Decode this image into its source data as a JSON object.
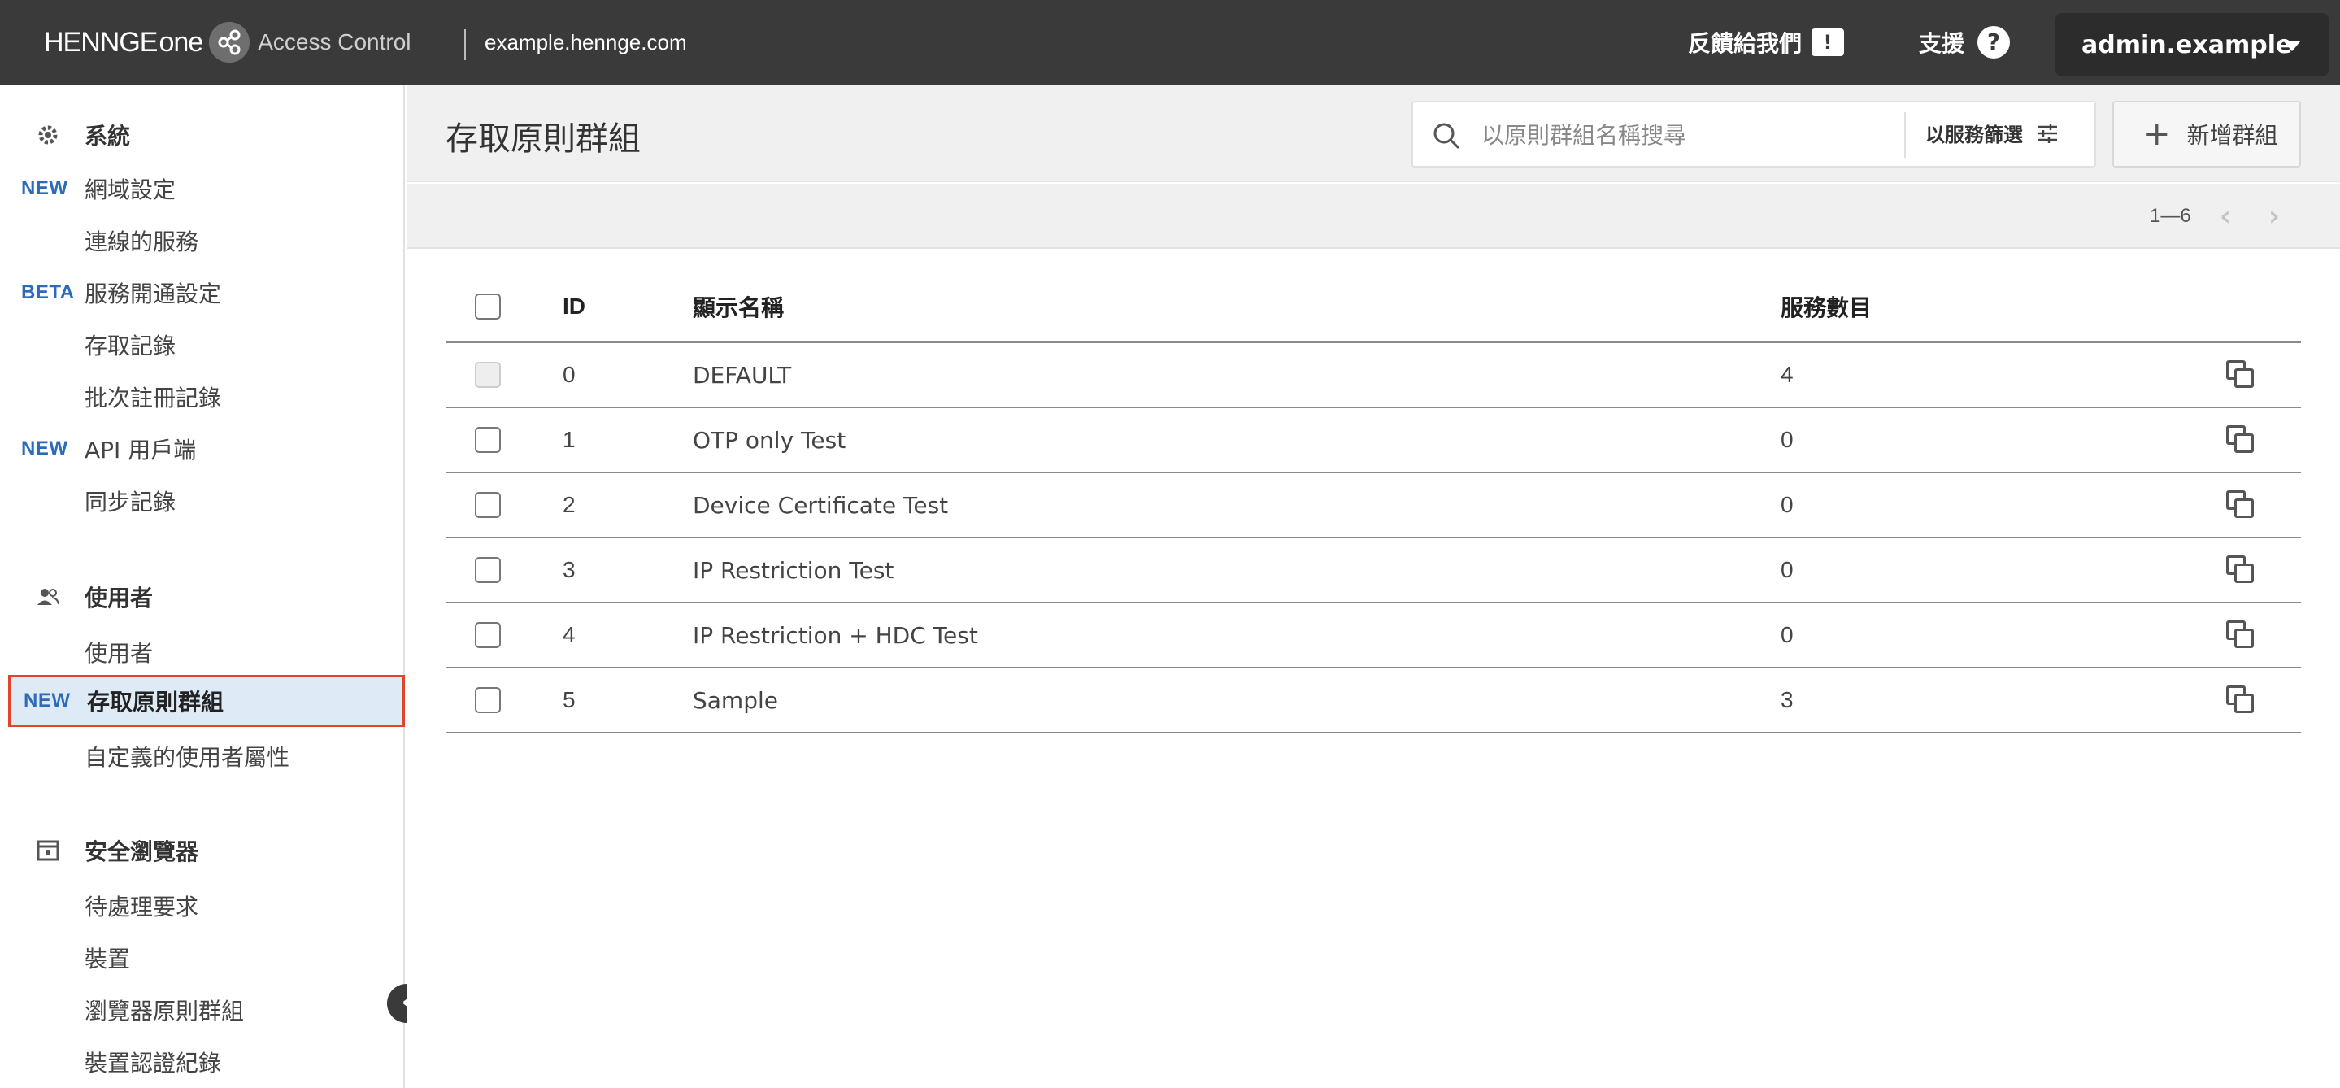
{
  "header": {
    "brand_main": "HENNGE",
    "brand_one": "one",
    "brand_app": "Access Control",
    "domain": "example.hennge.com",
    "feedback_label": "反饋給我們",
    "support_label": "支援",
    "account_label": "admin.example"
  },
  "sidebar": {
    "sections": [
      {
        "label": "系統",
        "icon": "gear-icon",
        "items": [
          {
            "tag": "NEW",
            "label": "網域設定"
          },
          {
            "tag": "",
            "label": "連線的服務"
          },
          {
            "tag": "BETA",
            "label": "服務開通設定"
          },
          {
            "tag": "",
            "label": "存取記錄"
          },
          {
            "tag": "",
            "label": "批次註冊記錄"
          },
          {
            "tag": "NEW",
            "label": "API 用戶端"
          },
          {
            "tag": "",
            "label": "同步記錄"
          }
        ]
      },
      {
        "label": "使用者",
        "icon": "users-icon",
        "items": [
          {
            "tag": "",
            "label": "使用者"
          },
          {
            "tag": "NEW",
            "label": "存取原則群組"
          },
          {
            "tag": "",
            "label": "自定義的使用者屬性"
          }
        ]
      },
      {
        "label": "安全瀏覽器",
        "icon": "browser-icon",
        "items": [
          {
            "tag": "",
            "label": "待處理要求"
          },
          {
            "tag": "",
            "label": "裝置"
          },
          {
            "tag": "",
            "label": "瀏覽器原則群組"
          },
          {
            "tag": "",
            "label": "裝置認證紀錄"
          }
        ]
      }
    ]
  },
  "main": {
    "title": "存取原則群組",
    "search_placeholder": "以原則群組名稱搜尋",
    "filter_label": "以服務篩選",
    "add_label": "新增群組",
    "pager_range": "1—6",
    "columns": {
      "id": "ID",
      "name": "顯示名稱",
      "count": "服務數目"
    },
    "rows": [
      {
        "id": "0",
        "name": "DEFAULT",
        "count": "4"
      },
      {
        "id": "1",
        "name": "OTP only Test",
        "count": "0"
      },
      {
        "id": "2",
        "name": "Device Certificate Test",
        "count": "0"
      },
      {
        "id": "3",
        "name": "IP Restriction Test",
        "count": "0"
      },
      {
        "id": "4",
        "name": "IP Restriction + HDC Test",
        "count": "0"
      },
      {
        "id": "5",
        "name": "Sample",
        "count": "3"
      }
    ]
  }
}
